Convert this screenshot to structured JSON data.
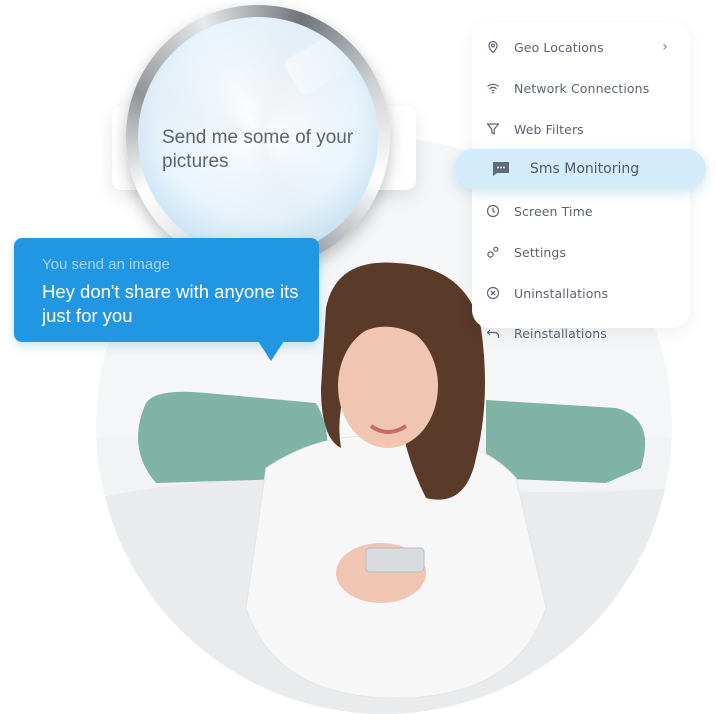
{
  "menu": {
    "items": [
      {
        "label": "Geo Locations",
        "icon": "location-pin-icon",
        "has_chevron": true,
        "chevron": "›"
      },
      {
        "label": "Network Connections",
        "icon": "wifi-icon"
      },
      {
        "label": "Web Filters",
        "icon": "filter-icon"
      },
      {
        "label": "Screen Time",
        "icon": "clock-icon"
      },
      {
        "label": "Settings",
        "icon": "gear-icon"
      },
      {
        "label": "Uninstallations",
        "icon": "x-circle-icon"
      },
      {
        "label": "Reinstallations",
        "icon": "undo-arrow-icon"
      }
    ],
    "active": {
      "label": "Sms Monitoring",
      "icon": "chat-bubble-icon"
    }
  },
  "lens_message": "Send me some of your pictures",
  "bubble": {
    "sub": "You send an image",
    "main": "Hey don't share with anyone its just for you"
  },
  "colors": {
    "accent": "#2196e3",
    "active_bg": "#d4ebf9",
    "menu_text": "#5b6472"
  }
}
